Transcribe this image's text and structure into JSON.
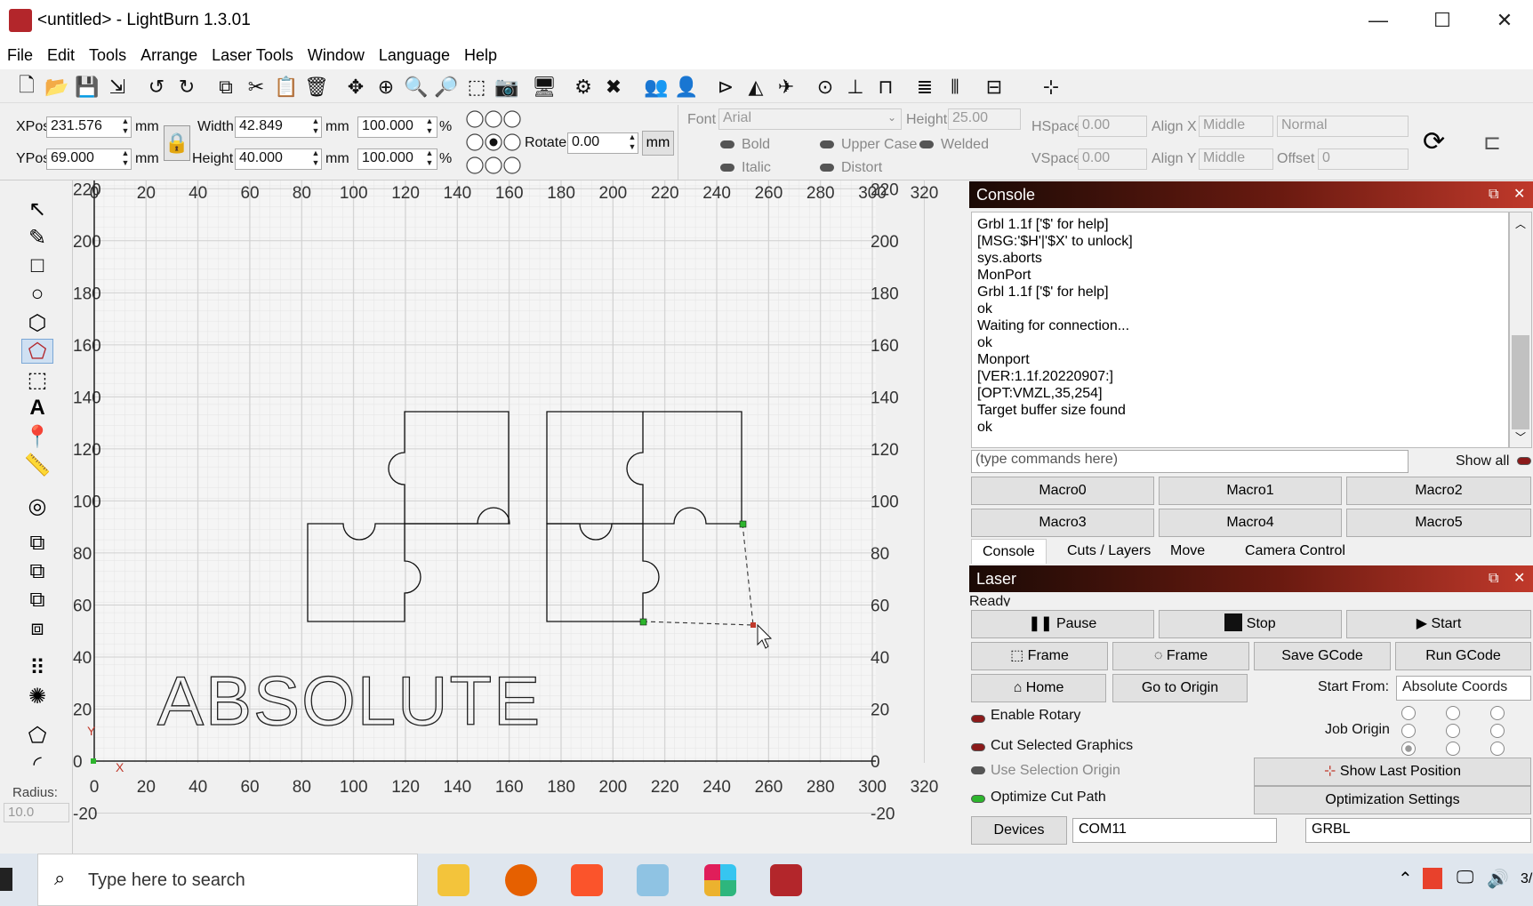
{
  "window": {
    "title": "<untitled> - LightBurn 1.3.01",
    "minimize": "—",
    "maximize": "☐",
    "close": "✕"
  },
  "menu": [
    "File",
    "Edit",
    "Tools",
    "Arrange",
    "Laser Tools",
    "Window",
    "Language",
    "Help"
  ],
  "props": {
    "xpos_label": "XPos",
    "xpos": "231.576",
    "ypos_label": "YPos",
    "ypos": "69.000",
    "width_label": "Width",
    "width": "42.849",
    "height_label": "Height",
    "height": "40.000",
    "unit": "mm",
    "pct1": "100.000",
    "pct2": "100.000",
    "pct": "%",
    "rotate_label": "Rotate",
    "rotate": "0.00",
    "mm_btn": "mm",
    "font_label": "Font",
    "font": "Arial",
    "fheight_label": "Height",
    "fheight": "25.00",
    "bold": "Bold",
    "italic": "Italic",
    "upper": "Upper Case",
    "welded": "Welded",
    "distort": "Distort",
    "hspace_label": "HSpace",
    "hspace": "0.00",
    "vspace_label": "VSpace",
    "vspace": "0.00",
    "alignx_label": "Align X",
    "alignx": "Middle",
    "aligny_label": "Align Y",
    "aligny": "Middle",
    "mode": "Normal",
    "offset_label": "Offset",
    "offset": "0"
  },
  "left_tools": {
    "radius_label": "Radius:",
    "radius": "10.0"
  },
  "canvas": {
    "x_ticks": [
      "0",
      "20",
      "40",
      "60",
      "80",
      "100",
      "120",
      "140",
      "160",
      "180",
      "200",
      "220",
      "240",
      "260",
      "280",
      "300",
      "320"
    ],
    "y_ticks": [
      "220",
      "200",
      "180",
      "160",
      "140",
      "120",
      "100",
      "80",
      "60",
      "40",
      "20",
      "0",
      "-20"
    ],
    "text_object": "ABSOLUTE",
    "axis_x": "X",
    "axis_y": "Y"
  },
  "console": {
    "title": "Console",
    "lines": [
      "Grbl 1.1f ['$' for help]",
      "[MSG:'$H'|'$X' to unlock]",
      "sys.aborts",
      "MonPort",
      "Grbl 1.1f ['$' for help]",
      "ok",
      "Waiting for connection...",
      "ok",
      "Monport",
      "[VER:1.1f.20220907:]",
      "[OPT:VMZL,35,254]",
      "Target buffer size found",
      "ok"
    ],
    "input_placeholder": "(type commands here)",
    "show_all": "Show all",
    "macros": [
      "Macro0",
      "Macro1",
      "Macro2",
      "Macro3",
      "Macro4",
      "Macro5"
    ],
    "tabs": [
      "Console",
      "Cuts / Layers",
      "Move",
      "Camera Control"
    ]
  },
  "laser": {
    "title": "Laser",
    "status": "Ready",
    "pause": "Pause",
    "stop": "Stop",
    "start": "Start",
    "frame1": "Frame",
    "frame2": "Frame",
    "save_gcode": "Save GCode",
    "run_gcode": "Run GCode",
    "home": "Home",
    "go_origin": "Go to Origin",
    "start_from_label": "Start From:",
    "start_from": "Absolute Coords",
    "enable_rotary": "Enable Rotary",
    "job_origin": "Job Origin",
    "cut_selected": "Cut Selected Graphics",
    "use_selection": "Use Selection Origin",
    "show_last": "Show Last Position",
    "optimize": "Optimize Cut Path",
    "opt_settings": "Optimization Settings",
    "devices": "Devices",
    "port": "COM11",
    "controller": "GRBL"
  },
  "taskbar": {
    "search": "Type here to search",
    "clock": "3/"
  },
  "colors": {
    "accent_red": "#b3262b",
    "led_on": "#2db52d",
    "led_off": "#8b1a1a"
  }
}
